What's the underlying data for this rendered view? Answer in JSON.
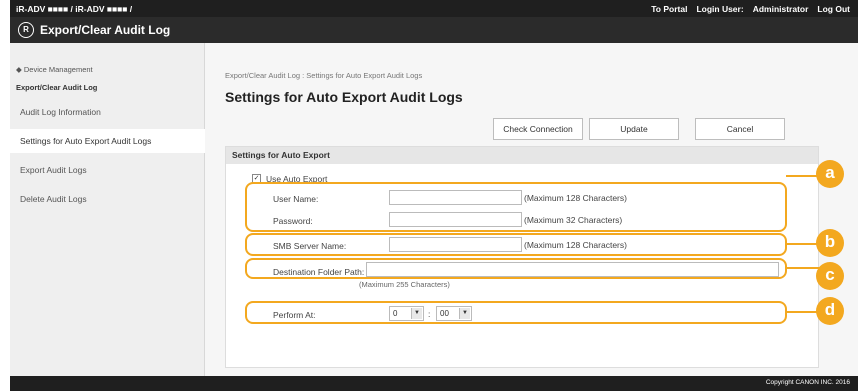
{
  "header": {
    "model_text": "iR-ADV ■■■■ / iR-ADV ■■■■ /",
    "portal_link": "To Portal",
    "login_user_label": "Login User:",
    "login_user_name": "Administrator",
    "logout_link": "Log Out"
  },
  "titlebar": {
    "logo_text": "R",
    "title": "Export/Clear Audit Log"
  },
  "sidebar": {
    "back_link": "◆ Device Management",
    "group_title": "Export/Clear Audit Log",
    "items": [
      {
        "label": "Audit Log Information"
      },
      {
        "label": "Settings for Auto Export Audit Logs"
      },
      {
        "label": "Export Audit Logs"
      },
      {
        "label": "Delete Audit Logs"
      }
    ]
  },
  "main": {
    "breadcrumb": "Export/Clear Audit Log : Settings for Auto Export Audit Logs",
    "page_title": "Settings for Auto Export Audit Logs",
    "buttons": {
      "check_connection": "Check Connection",
      "update": "Update",
      "cancel": "Cancel"
    }
  },
  "form": {
    "section_title": "Settings for Auto Export",
    "use_auto_export": {
      "label": "Use Auto Export",
      "checked": true
    },
    "user_name": {
      "label": "User Name:",
      "value": "",
      "hint": "(Maximum 128 Characters)"
    },
    "password": {
      "label": "Password:",
      "value": "",
      "hint": "(Maximum 32 Characters)"
    },
    "smb_server": {
      "label": "SMB Server Name:",
      "value": "",
      "hint": "(Maximum 128 Characters)"
    },
    "destination_folder": {
      "label": "Destination Folder Path:",
      "value": "",
      "hint": "(Maximum 255 Characters)"
    },
    "perform_at": {
      "label": "Perform At:",
      "hour": "0",
      "separator": ":",
      "minute": "00"
    }
  },
  "callouts": {
    "a": "a",
    "b": "b",
    "c": "c",
    "d": "d"
  },
  "icons": {
    "scroll_top": "scroll-to-top-icon",
    "check": "checkmark-icon",
    "dropdown": "chevron-down-icon"
  },
  "colors": {
    "topbar": "#1f1f1f",
    "titlebar": "#2b2b2b",
    "callout": "#f3a81f",
    "sidebar": "#efefef"
  },
  "footer": {
    "copyright": "Copyright CANON INC. 2016"
  }
}
